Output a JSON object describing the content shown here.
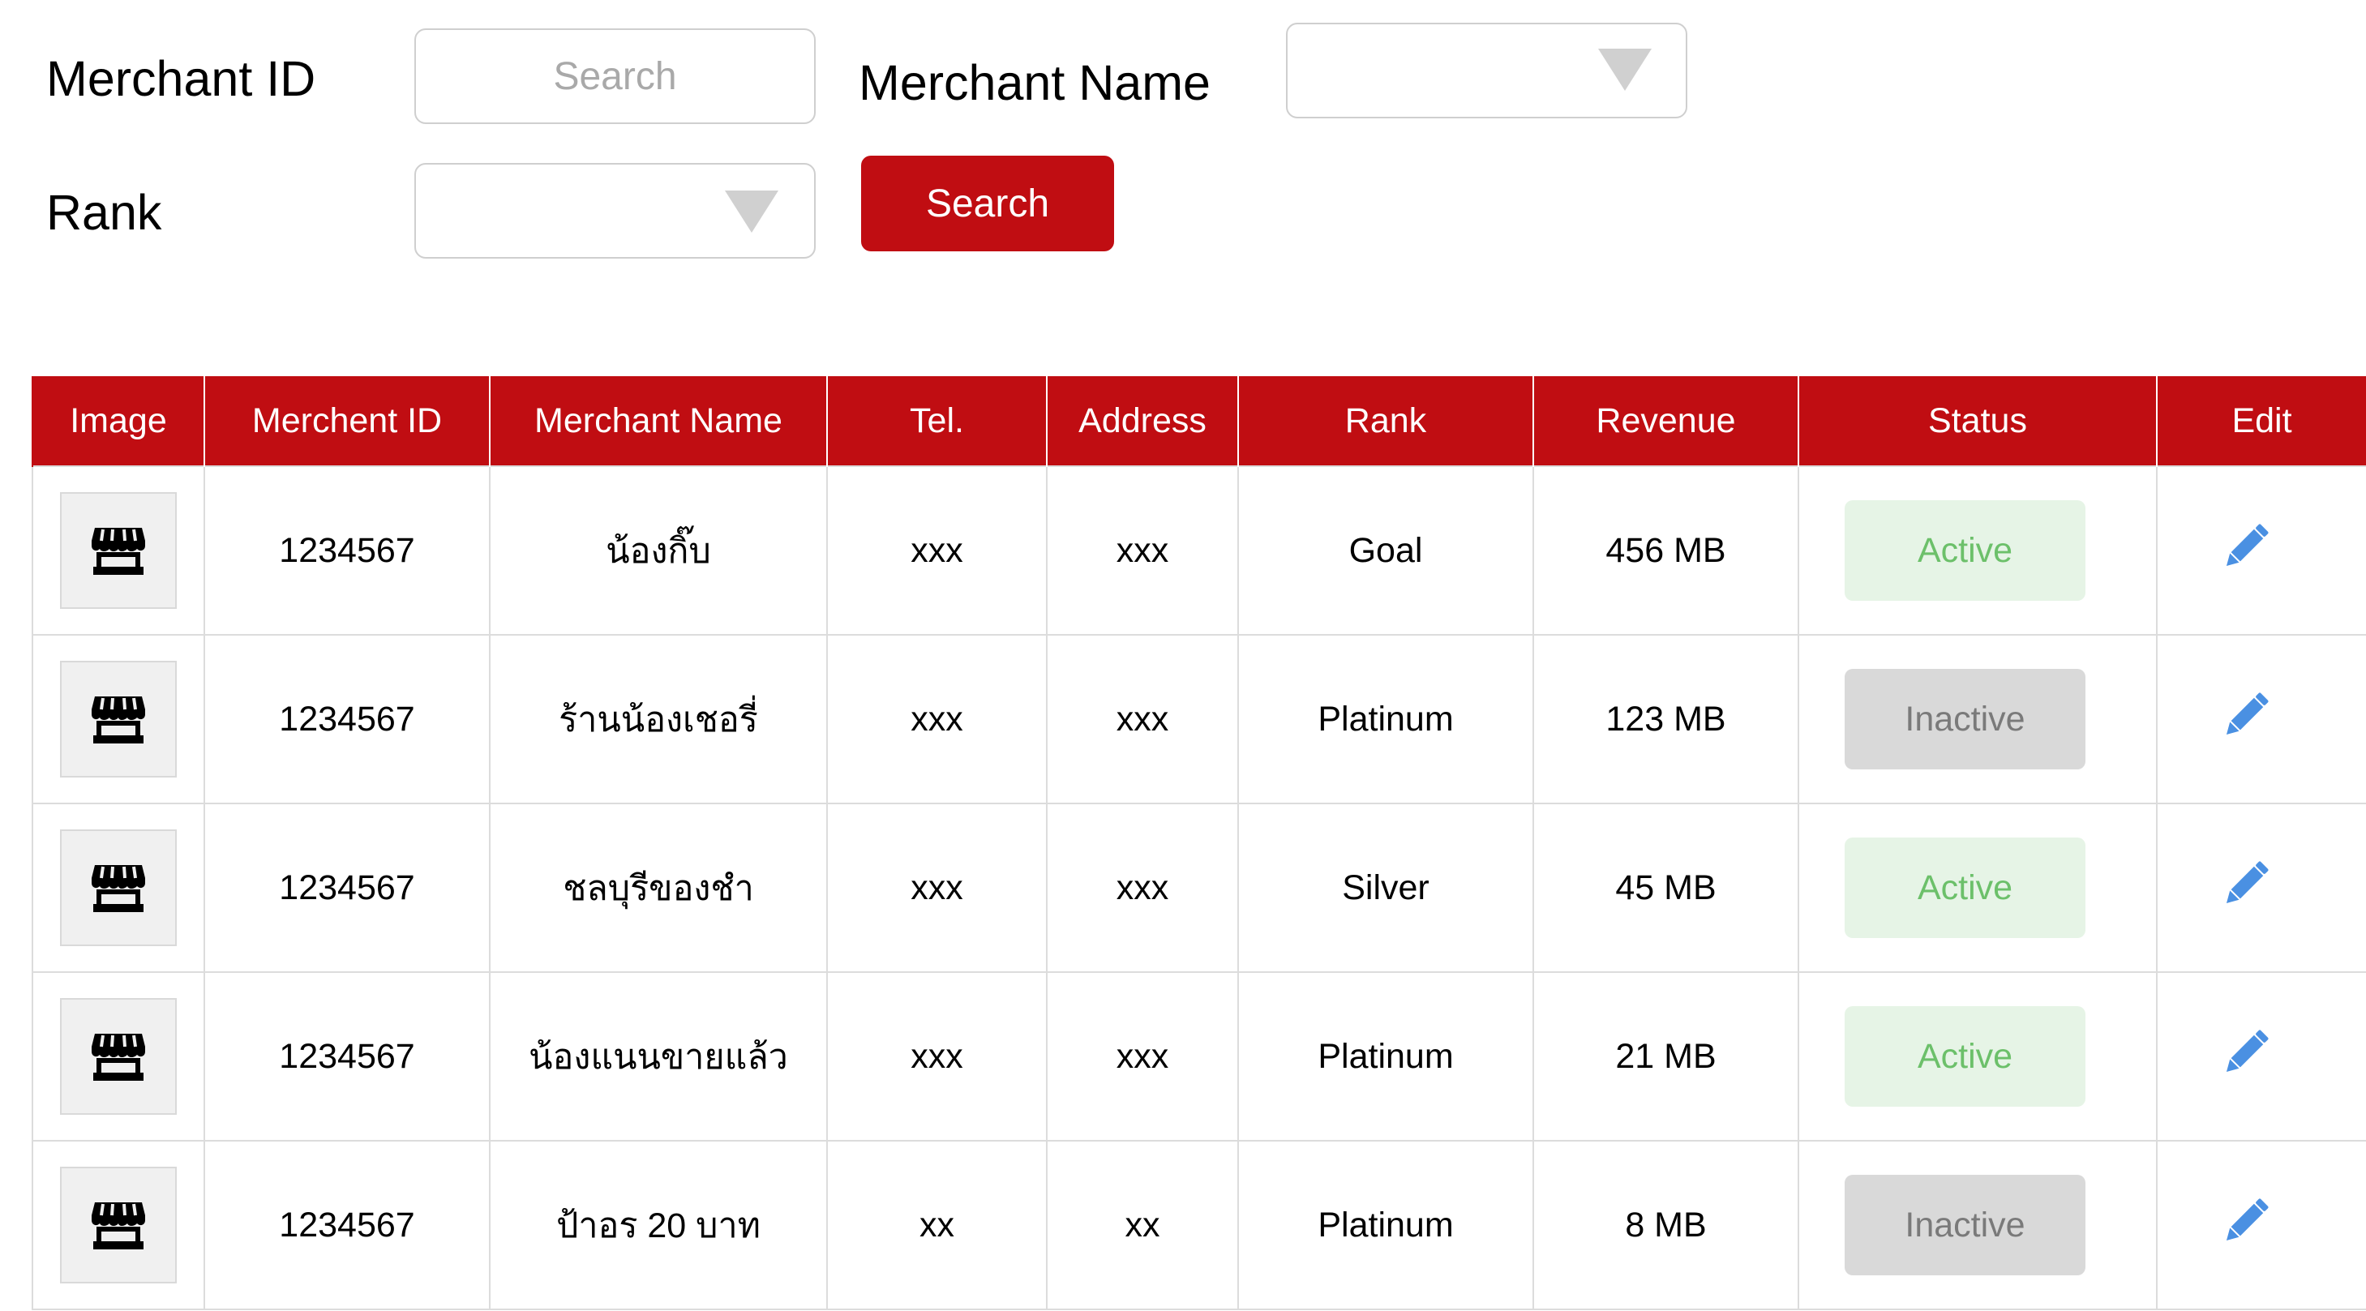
{
  "filters": {
    "merchant_id_label": "Merchant ID",
    "merchant_id_placeholder": "Search",
    "merchant_id_value": "",
    "merchant_name_label": "Merchant Name",
    "merchant_name_value": "",
    "rank_label": "Rank",
    "rank_value": "",
    "search_button_label": "Search"
  },
  "table": {
    "headers": [
      "Image",
      "Merchent ID",
      "Merchant Name",
      "Tel.",
      "Address",
      "Rank",
      "Revenue",
      "Status",
      "Edit"
    ],
    "rows": [
      {
        "image_icon": "store-icon",
        "merchant_id": "1234567",
        "merchant_name": "น้องกิ๊บ",
        "tel": "xxx",
        "address": "xxx",
        "rank": "Goal",
        "revenue": "456 MB",
        "status": "Active",
        "status_type": "active",
        "edit_icon": "pencil-icon"
      },
      {
        "image_icon": "store-icon",
        "merchant_id": "1234567",
        "merchant_name": "ร้านน้องเชอรี่",
        "tel": "xxx",
        "address": "xxx",
        "rank": "Platinum",
        "revenue": "123 MB",
        "status": "Inactive",
        "status_type": "inactive",
        "edit_icon": "pencil-icon"
      },
      {
        "image_icon": "store-icon",
        "merchant_id": "1234567",
        "merchant_name": "ชลบุรีของชำ",
        "tel": "xxx",
        "address": "xxx",
        "rank": "Silver",
        "revenue": "45 MB",
        "status": "Active",
        "status_type": "active",
        "edit_icon": "pencil-icon"
      },
      {
        "image_icon": "store-icon",
        "merchant_id": "1234567",
        "merchant_name": "น้องแนนขายแล้ว",
        "tel": "xxx",
        "address": "xxx",
        "rank": "Platinum",
        "revenue": "21 MB",
        "status": "Active",
        "status_type": "active",
        "edit_icon": "pencil-icon"
      },
      {
        "image_icon": "store-icon",
        "merchant_id": "1234567",
        "merchant_name": "ป้าอร 20 บาท",
        "tel": "xx",
        "address": "xx",
        "rank": "Platinum",
        "revenue": "8 MB",
        "status": "Inactive",
        "status_type": "inactive",
        "edit_icon": "pencil-icon"
      }
    ]
  },
  "colors": {
    "brand_red": "#c00d12",
    "active_bg": "#e6f4e6",
    "active_text": "#6cc06a",
    "inactive_bg": "#d9d9d9",
    "inactive_text": "#7a7a7a",
    "edit_icon": "#4a90e2"
  }
}
